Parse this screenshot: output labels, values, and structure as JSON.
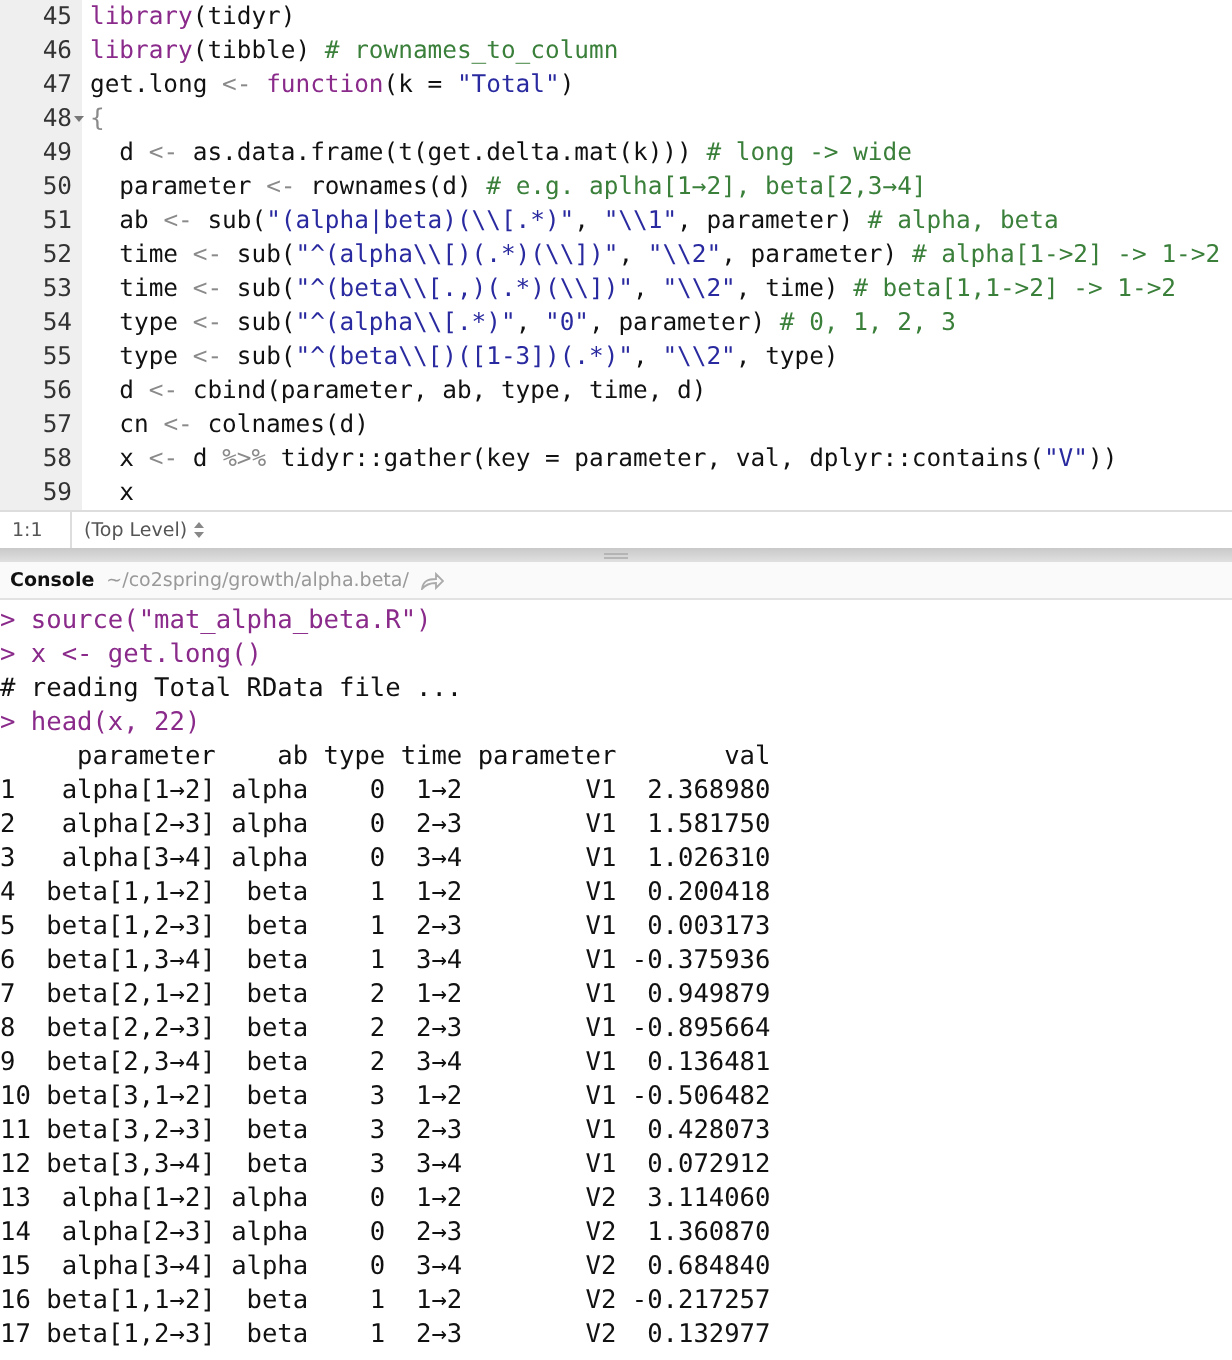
{
  "editor": {
    "lines": [
      {
        "number": "45",
        "foldable": false,
        "tokens": [
          {
            "kind": "keyword",
            "text": "library"
          },
          {
            "kind": "plain",
            "text": "(tidyr)"
          }
        ]
      },
      {
        "number": "46",
        "foldable": false,
        "tokens": [
          {
            "kind": "keyword",
            "text": "library"
          },
          {
            "kind": "plain",
            "text": "(tibble) "
          },
          {
            "kind": "comment",
            "text": "# rownames_to_column"
          }
        ]
      },
      {
        "number": "47",
        "foldable": false,
        "tokens": [
          {
            "kind": "plain",
            "text": "get.long "
          },
          {
            "kind": "operator",
            "text": "<- "
          },
          {
            "kind": "keyword",
            "text": "function"
          },
          {
            "kind": "plain",
            "text": "(k = "
          },
          {
            "kind": "string",
            "text": "\"Total\""
          },
          {
            "kind": "plain",
            "text": ")"
          }
        ]
      },
      {
        "number": "48",
        "foldable": true,
        "tokens": [
          {
            "kind": "operator",
            "text": "{"
          }
        ]
      },
      {
        "number": "49",
        "foldable": false,
        "tokens": [
          {
            "kind": "plain",
            "text": "  d "
          },
          {
            "kind": "operator",
            "text": "<-"
          },
          {
            "kind": "plain",
            "text": " as.data.frame(t(get.delta.mat(k))) "
          },
          {
            "kind": "comment",
            "text": "# long -> wide"
          }
        ]
      },
      {
        "number": "50",
        "foldable": false,
        "tokens": [
          {
            "kind": "plain",
            "text": "  parameter "
          },
          {
            "kind": "operator",
            "text": "<-"
          },
          {
            "kind": "plain",
            "text": " rownames(d) "
          },
          {
            "kind": "comment",
            "text": "# e.g. aplha[1→2], beta[2,3→4]"
          }
        ]
      },
      {
        "number": "51",
        "foldable": false,
        "tokens": [
          {
            "kind": "plain",
            "text": "  ab "
          },
          {
            "kind": "operator",
            "text": "<-"
          },
          {
            "kind": "plain",
            "text": " sub("
          },
          {
            "kind": "string",
            "text": "\"(alpha|beta)(\\\\[.*)\""
          },
          {
            "kind": "plain",
            "text": ", "
          },
          {
            "kind": "string",
            "text": "\"\\\\1\""
          },
          {
            "kind": "plain",
            "text": ", parameter) "
          },
          {
            "kind": "comment",
            "text": "# alpha, beta"
          }
        ]
      },
      {
        "number": "52",
        "foldable": false,
        "tokens": [
          {
            "kind": "plain",
            "text": "  time "
          },
          {
            "kind": "operator",
            "text": "<-"
          },
          {
            "kind": "plain",
            "text": " sub("
          },
          {
            "kind": "string",
            "text": "\"^(alpha\\\\[)(.*)(\\\\])\""
          },
          {
            "kind": "plain",
            "text": ", "
          },
          {
            "kind": "string",
            "text": "\"\\\\2\""
          },
          {
            "kind": "plain",
            "text": ", parameter) "
          },
          {
            "kind": "comment",
            "text": "# alpha[1->2] -> 1->2"
          }
        ]
      },
      {
        "number": "53",
        "foldable": false,
        "tokens": [
          {
            "kind": "plain",
            "text": "  time "
          },
          {
            "kind": "operator",
            "text": "<-"
          },
          {
            "kind": "plain",
            "text": " sub("
          },
          {
            "kind": "string",
            "text": "\"^(beta\\\\[.,)(.*)(\\\\])\""
          },
          {
            "kind": "plain",
            "text": ", "
          },
          {
            "kind": "string",
            "text": "\"\\\\2\""
          },
          {
            "kind": "plain",
            "text": ", time) "
          },
          {
            "kind": "comment",
            "text": "# beta[1,1->2] -> 1->2"
          }
        ]
      },
      {
        "number": "54",
        "foldable": false,
        "tokens": [
          {
            "kind": "plain",
            "text": "  type "
          },
          {
            "kind": "operator",
            "text": "<-"
          },
          {
            "kind": "plain",
            "text": " sub("
          },
          {
            "kind": "string",
            "text": "\"^(alpha\\\\[.*)\""
          },
          {
            "kind": "plain",
            "text": ", "
          },
          {
            "kind": "string",
            "text": "\"0\""
          },
          {
            "kind": "plain",
            "text": ", parameter) "
          },
          {
            "kind": "comment",
            "text": "# 0, 1, 2, 3"
          }
        ]
      },
      {
        "number": "55",
        "foldable": false,
        "tokens": [
          {
            "kind": "plain",
            "text": "  type "
          },
          {
            "kind": "operator",
            "text": "<-"
          },
          {
            "kind": "plain",
            "text": " sub("
          },
          {
            "kind": "string",
            "text": "\"^(beta\\\\[)([1-3])(.*)\""
          },
          {
            "kind": "plain",
            "text": ", "
          },
          {
            "kind": "string",
            "text": "\"\\\\2\""
          },
          {
            "kind": "plain",
            "text": ", type)"
          }
        ]
      },
      {
        "number": "56",
        "foldable": false,
        "tokens": [
          {
            "kind": "plain",
            "text": "  d "
          },
          {
            "kind": "operator",
            "text": "<-"
          },
          {
            "kind": "plain",
            "text": " cbind(parameter, ab, type, time, d)"
          }
        ]
      },
      {
        "number": "57",
        "foldable": false,
        "tokens": [
          {
            "kind": "plain",
            "text": "  cn "
          },
          {
            "kind": "operator",
            "text": "<-"
          },
          {
            "kind": "plain",
            "text": " colnames(d)"
          }
        ]
      },
      {
        "number": "58",
        "foldable": false,
        "tokens": [
          {
            "kind": "plain",
            "text": "  x "
          },
          {
            "kind": "operator",
            "text": "<-"
          },
          {
            "kind": "plain",
            "text": " d "
          },
          {
            "kind": "operator",
            "text": "%>%"
          },
          {
            "kind": "plain",
            "text": " tidyr::gather(key = parameter, val, dplyr::contains("
          },
          {
            "kind": "string",
            "text": "\"V\""
          },
          {
            "kind": "plain",
            "text": "))"
          }
        ]
      },
      {
        "number": "59",
        "foldable": false,
        "tokens": [
          {
            "kind": "plain",
            "text": "  x"
          }
        ]
      }
    ],
    "status_bar": {
      "cursor": "1:1",
      "scope": "(Top Level)"
    }
  },
  "console": {
    "title": "Console",
    "path": "~/co2spring/growth/alpha.beta/",
    "lines": [
      {
        "kind": "input",
        "prompt": ">",
        "text": "source(\"mat_alpha_beta.R\")"
      },
      {
        "kind": "input",
        "prompt": ">",
        "text": "x <- get.long()"
      },
      {
        "kind": "output",
        "text": "# reading Total RData file ..."
      },
      {
        "kind": "input",
        "prompt": ">",
        "text": "head(x, 22)"
      },
      {
        "kind": "output",
        "text": "     parameter    ab type time parameter       val"
      },
      {
        "kind": "output",
        "text": "1   alpha[1→2] alpha    0  1→2        V1  2.368980"
      },
      {
        "kind": "output",
        "text": "2   alpha[2→3] alpha    0  2→3        V1  1.581750"
      },
      {
        "kind": "output",
        "text": "3   alpha[3→4] alpha    0  3→4        V1  1.026310"
      },
      {
        "kind": "output",
        "text": "4  beta[1,1→2]  beta    1  1→2        V1  0.200418"
      },
      {
        "kind": "output",
        "text": "5  beta[1,2→3]  beta    1  2→3        V1  0.003173"
      },
      {
        "kind": "output",
        "text": "6  beta[1,3→4]  beta    1  3→4        V1 -0.375936"
      },
      {
        "kind": "output",
        "text": "7  beta[2,1→2]  beta    2  1→2        V1  0.949879"
      },
      {
        "kind": "output",
        "text": "8  beta[2,2→3]  beta    2  2→3        V1 -0.895664"
      },
      {
        "kind": "output",
        "text": "9  beta[2,3→4]  beta    2  3→4        V1  0.136481"
      },
      {
        "kind": "output",
        "text": "10 beta[3,1→2]  beta    3  1→2        V1 -0.506482"
      },
      {
        "kind": "output",
        "text": "11 beta[3,2→3]  beta    3  2→3        V1  0.428073"
      },
      {
        "kind": "output",
        "text": "12 beta[3,3→4]  beta    3  3→4        V1  0.072912"
      },
      {
        "kind": "output",
        "text": "13  alpha[1→2] alpha    0  1→2        V2  3.114060"
      },
      {
        "kind": "output",
        "text": "14  alpha[2→3] alpha    0  2→3        V2  1.360870"
      },
      {
        "kind": "output",
        "text": "15  alpha[3→4] alpha    0  3→4        V2  0.684840"
      },
      {
        "kind": "output",
        "text": "16 beta[1,1→2]  beta    1  1→2        V2 -0.217257"
      },
      {
        "kind": "output",
        "text": "17 beta[1,2→3]  beta    1  2→3        V2  0.132977"
      }
    ]
  }
}
